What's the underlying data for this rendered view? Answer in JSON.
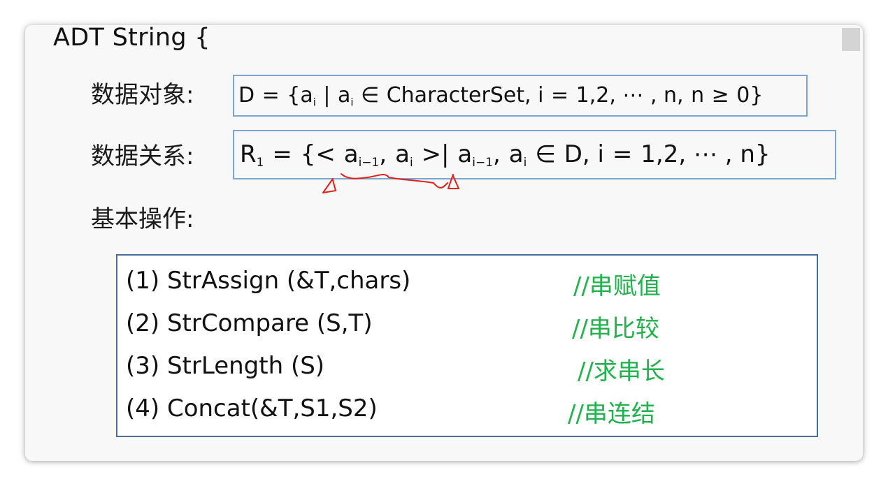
{
  "slide": {
    "title": "ADT String {",
    "data_object": {
      "label": "数据对象:",
      "formula": {
        "lhs": "D",
        "eq": "=",
        "open": "{a",
        "sub_i": "i",
        "bar": "|",
        "a2": "a",
        "sub_i2": "i",
        "elem": "∈",
        "set": "CharacterSet, i",
        "eq2": "=",
        "range": "1,2, ⋯ , n,",
        "n": "n",
        "ge": "≥",
        "tail": "0}"
      }
    },
    "data_relation": {
      "label": "数据关系:",
      "formula": {
        "lhs": "R",
        "sub_1": "1",
        "eq": "=",
        "open": "{<",
        "a1": "a",
        "sub_im1": "i−1",
        "comma1": ",",
        "a2": "a",
        "sub_i": "i",
        "close": ">|",
        "a3": "a",
        "sub_im1b": "i−1",
        "comma2": ",",
        "a4": "a",
        "sub_i2": "i",
        "elem": "∈",
        "tail1": "D, i",
        "eq2": "=",
        "tail2": "1,2, ⋯ , n}"
      }
    },
    "operations": {
      "label": "基本操作:",
      "items": [
        {
          "signature": "(1)  StrAssign (&T,chars)",
          "comment": "//串赋值"
        },
        {
          "signature": "(2) StrCompare (S,T)",
          "comment": "//串比较"
        },
        {
          "signature": "(3) StrLength (S)",
          "comment": "//求串长"
        },
        {
          "signature": "(4) Concat(&T,S1,S2)",
          "comment": "//串连结"
        }
      ]
    },
    "colors": {
      "comment_green": "#22b14c",
      "box_border_light": "#7aa6d4",
      "box_border_dark": "#4a6e99",
      "annotation_red": "#e0201c"
    }
  }
}
